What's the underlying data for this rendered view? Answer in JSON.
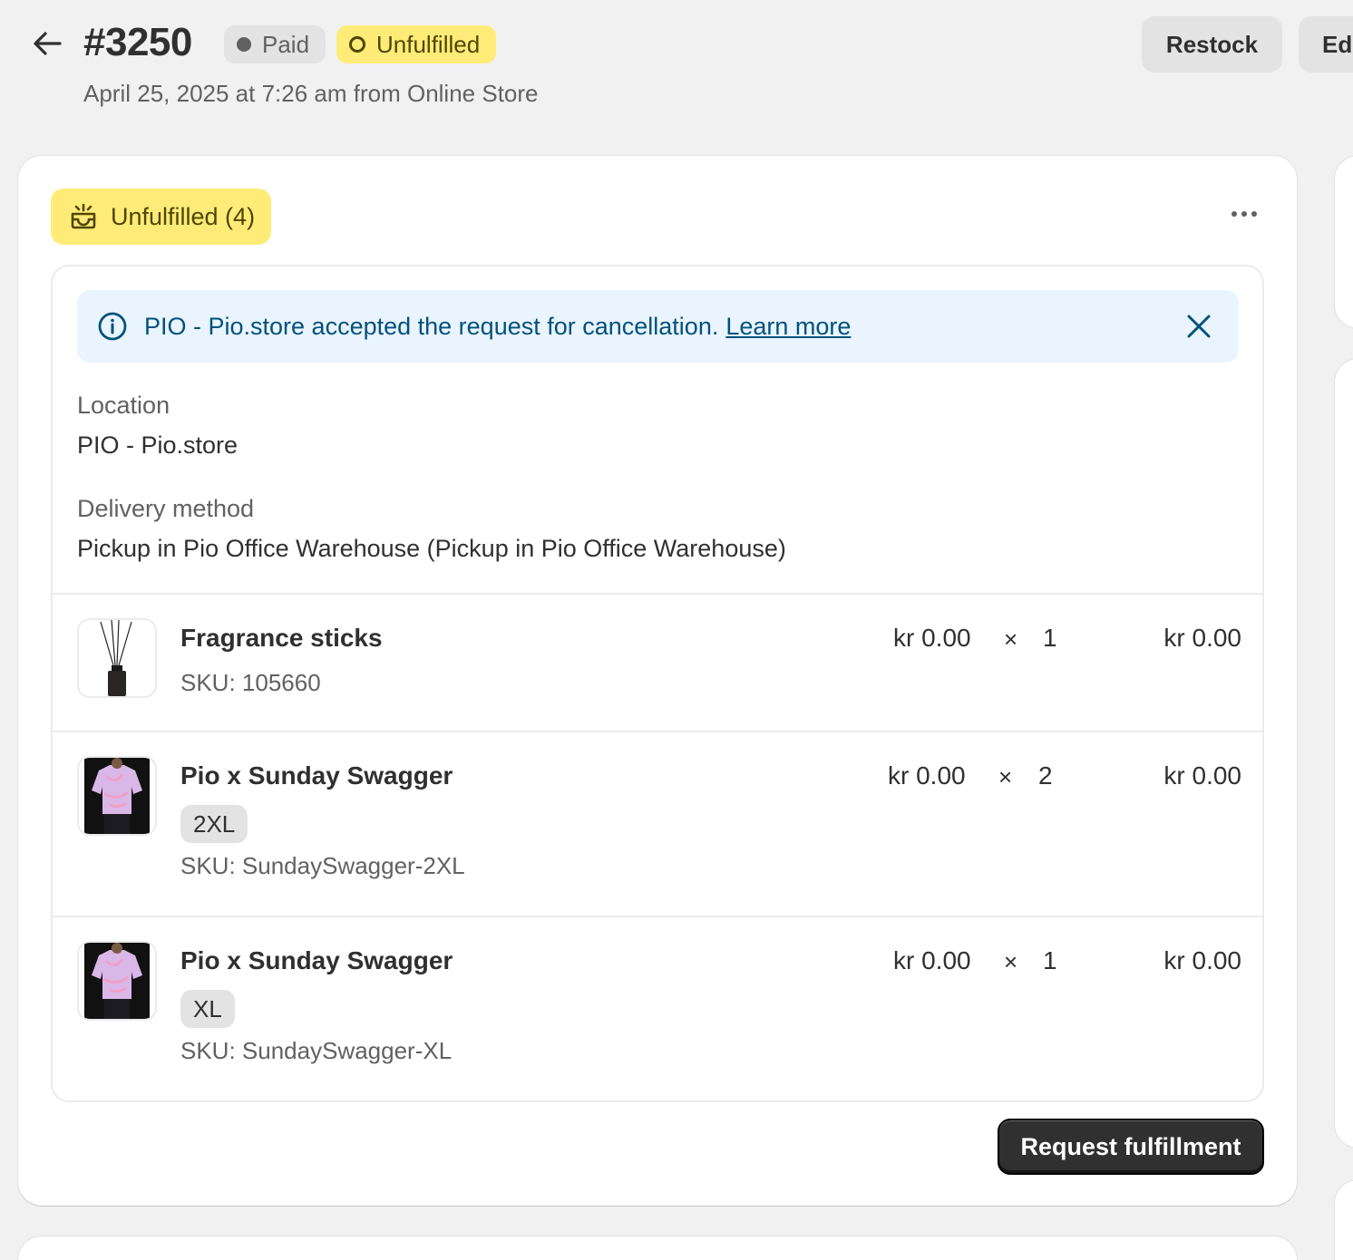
{
  "header": {
    "order_number": "#3250",
    "payment_status": "Paid",
    "fulfillment_status": "Unfulfilled",
    "subtitle": "April 25, 2025 at 7:26 am from Online Store",
    "restock_label": "Restock",
    "edit_label": "Edit"
  },
  "fulfillment_card": {
    "status_label": "Unfulfilled (4)",
    "banner": {
      "text": "PIO - Pio.store accepted the request for cancellation.",
      "link": "Learn more"
    },
    "location_label": "Location",
    "location_value": "PIO - Pio.store",
    "delivery_label": "Delivery method",
    "delivery_value": "Pickup in Pio Office Warehouse (Pickup in Pio Office Warehouse)",
    "items": [
      {
        "name": "Fragrance sticks",
        "variant": "",
        "sku": "SKU: 105660",
        "price": "kr 0.00",
        "times": "×",
        "qty": "1",
        "total": "kr 0.00"
      },
      {
        "name": "Pio x Sunday Swagger",
        "variant": "2XL",
        "sku": "SKU: SundaySwagger-2XL",
        "price": "kr 0.00",
        "times": "×",
        "qty": "2",
        "total": "kr 0.00"
      },
      {
        "name": "Pio x Sunday Swagger",
        "variant": "XL",
        "sku": "SKU: SundaySwagger-XL",
        "price": "kr 0.00",
        "times": "×",
        "qty": "1",
        "total": "kr 0.00"
      }
    ],
    "primary_button": "Request fulfillment"
  },
  "icons": {
    "back": "arrow-left-icon",
    "status": "package-icon",
    "more": "more-horizontal-icon",
    "info": "info-icon",
    "close": "close-icon"
  },
  "colors": {
    "background": "#f1f1f1",
    "unfulfilled_badge": "#ffeb78",
    "info_banner": "#eaf4ff",
    "primary_button": "#303030"
  }
}
